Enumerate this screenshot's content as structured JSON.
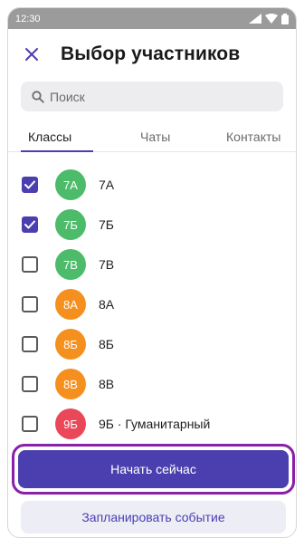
{
  "status_bar": {
    "time": "12:30"
  },
  "header": {
    "title": "Выбор участников"
  },
  "search": {
    "placeholder": "Поиск"
  },
  "tabs": [
    {
      "label": "Классы",
      "active": true
    },
    {
      "label": "Чаты",
      "active": false
    },
    {
      "label": "Контакты",
      "active": false
    }
  ],
  "participants": [
    {
      "avatar": "7А",
      "label": "7А",
      "checked": true,
      "color": "#4cbb6a"
    },
    {
      "avatar": "7Б",
      "label": "7Б",
      "checked": true,
      "color": "#4cbb6a"
    },
    {
      "avatar": "7В",
      "label": "7В",
      "checked": false,
      "color": "#4cbb6a"
    },
    {
      "avatar": "8А",
      "label": "8А",
      "checked": false,
      "color": "#f5901f"
    },
    {
      "avatar": "8Б",
      "label": "8Б",
      "checked": false,
      "color": "#f5901f"
    },
    {
      "avatar": "8В",
      "label": "8В",
      "checked": false,
      "color": "#f5901f"
    },
    {
      "avatar": "9Б",
      "label": "9Б · Гуманитарный",
      "checked": false,
      "color": "#ea4759"
    }
  ],
  "actions": {
    "start_now": "Начать сейчас",
    "schedule_event": "Запланировать событие"
  },
  "colors": {
    "accent": "#4b3fb0",
    "highlight": "#8a1fa8",
    "status_bar": "#9b9b9b"
  }
}
